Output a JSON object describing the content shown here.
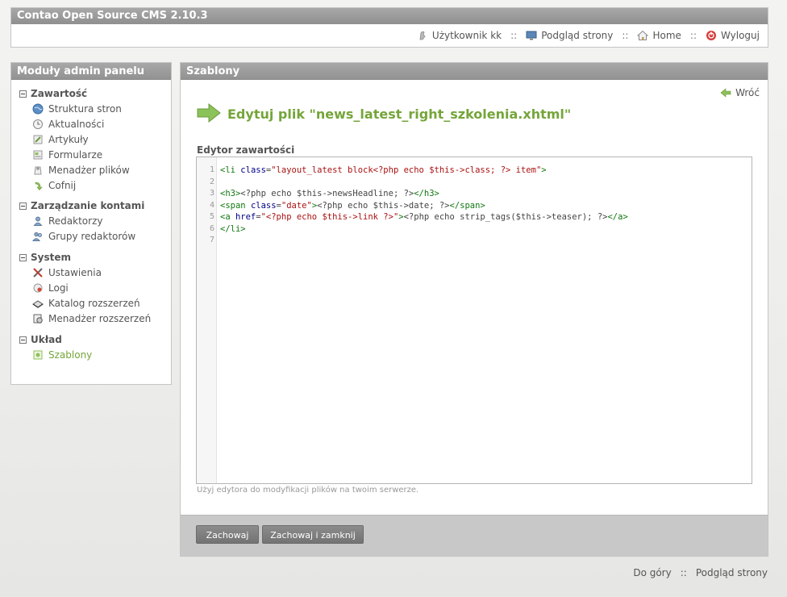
{
  "header": {
    "title": "Contao Open Source CMS 2.10.3",
    "user_label": "Użytkownik kk",
    "preview_label": "Podgląd strony",
    "home_label": "Home",
    "logout_label": "Wyloguj",
    "separator": "::"
  },
  "sidebar": {
    "title": "Moduły admin panelu",
    "groups": [
      {
        "title": "Zawartość",
        "items": [
          "Struktura stron",
          "Aktualności",
          "Artykuły",
          "Formularze",
          "Menadżer plików",
          "Cofnij"
        ]
      },
      {
        "title": "Zarządzanie kontami",
        "items": [
          "Redaktorzy",
          "Grupy redaktorów"
        ]
      },
      {
        "title": "System",
        "items": [
          "Ustawienia",
          "Logi",
          "Katalog rozszerzeń",
          "Menadżer rozszerzeń"
        ]
      },
      {
        "title": "Układ",
        "items": [
          "Szablony"
        ]
      }
    ]
  },
  "main": {
    "title": "Szablony",
    "back_label": "Wróć",
    "heading": "Edytuj plik \"news_latest_right_szkolenia.xhtml\"",
    "editor_label": "Edytor zawartości",
    "line_numbers": [
      "1",
      "2",
      "3",
      "4",
      "5",
      "6",
      "7"
    ],
    "hint": "Użyj edytora do modyfikacji plików na twoim serwerze.",
    "save_label": "Zachowaj",
    "save_close_label": "Zachowaj i zamknij"
  },
  "code": {
    "l1": {
      "a": "<li ",
      "b": "class",
      "c": "=",
      "d": "\"layout_latest block<?php echo $this->class; ?> item\"",
      "e": ">"
    },
    "l3": {
      "a": "<h3>",
      "b": "<?php echo $this->newsHeadline; ?>",
      "c": "</h3>"
    },
    "l4": {
      "a": "<span ",
      "b": "class",
      "c": "=",
      "d": "\"date\"",
      "e": ">",
      "f": "<?php echo $this->date; ?>",
      "g": "</span>"
    },
    "l5": {
      "a": "<a ",
      "b": "href",
      "c": "=",
      "d": "\"<?php echo $this->link ?>\"",
      "e": ">",
      "f": "<?php echo strip_tags($this->teaser); ?>",
      "g": "</a>"
    },
    "l6": {
      "a": "</li>"
    }
  },
  "footer": {
    "top_label": "Do góry",
    "preview_label": "Podgląd strony"
  },
  "colors": {
    "accent_green": "#75a53a",
    "header_gray": "#9b9b9b",
    "button_gray": "#7f7f7f"
  }
}
